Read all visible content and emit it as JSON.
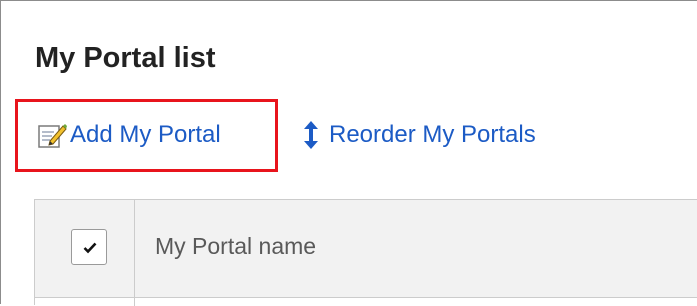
{
  "page": {
    "title": "My Portal list"
  },
  "actions": {
    "add_label": "Add My Portal",
    "reorder_label": "Reorder My Portals"
  },
  "table": {
    "columns": [
      "My Portal name"
    ],
    "select_all_checked": true
  },
  "icons": {
    "add": "edit-note-icon",
    "reorder": "up-down-arrow-icon"
  },
  "colors": {
    "link": "#1c5bc5",
    "highlight": "#e8141c",
    "header_bg": "#f2f2f2"
  }
}
